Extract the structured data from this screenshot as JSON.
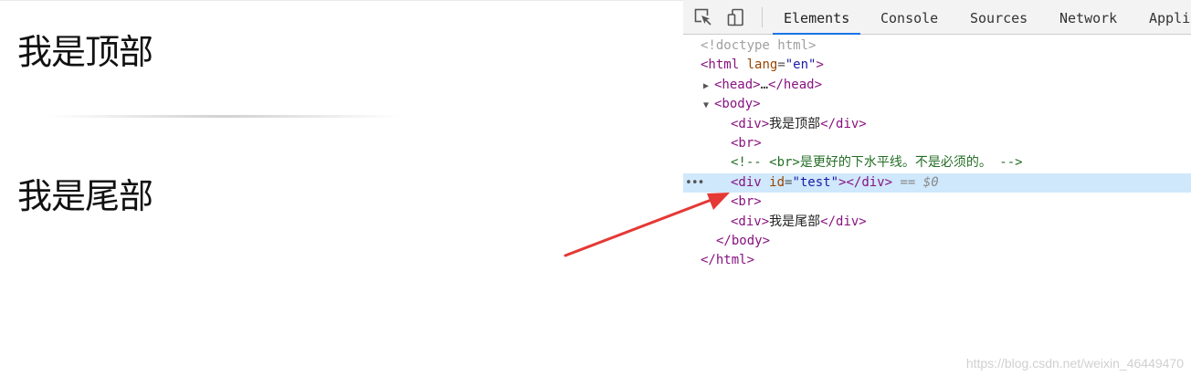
{
  "page": {
    "top_text": "我是顶部",
    "bottom_text": "我是尾部"
  },
  "devtools": {
    "tabs": [
      {
        "label": "Elements",
        "active": true
      },
      {
        "label": "Console",
        "active": false
      },
      {
        "label": "Sources",
        "active": false
      },
      {
        "label": "Network",
        "active": false
      },
      {
        "label": "Appli",
        "active": false
      }
    ],
    "icons": {
      "inspect": "inspect-element-icon",
      "device": "device-toolbar-icon"
    },
    "dom": {
      "doctype": "<!doctype html>",
      "html_open": "<html",
      "html_attr": "lang",
      "html_val": "\"en\"",
      "head_tag": "<head>",
      "head_ellipsis": "…",
      "head_close": "</head>",
      "body_open": "<body>",
      "div1_open": "<div>",
      "div1_text": "我是顶部",
      "div1_close": "</div>",
      "br1": "<br>",
      "comment": "<!-- <br>是更好的下水平线。不是必须的。 -->",
      "sel_div_open": "<div",
      "sel_attr": "id",
      "sel_val": "\"test\"",
      "sel_div_close": "</div>",
      "sel_suffix": "== $0",
      "br2": "<br>",
      "div2_open": "<div>",
      "div2_text": "我是尾部",
      "div2_close": "</div>",
      "body_close": "</body>",
      "html_close": "</html>",
      "selected_dots": "•••"
    }
  },
  "watermark": "https://blog.csdn.net/weixin_46449470",
  "colors": {
    "accent": "#1a73e8",
    "selection": "#cfe8fc",
    "arrow": "#e53935"
  }
}
